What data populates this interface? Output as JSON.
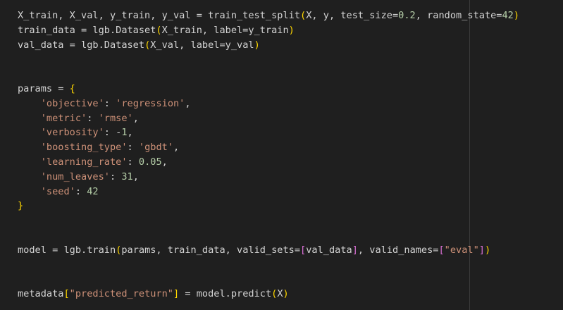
{
  "editor": {
    "language": "python",
    "lines": [
      [
        {
          "text": "X_train, X_val, y_train, y_val = train_test_split",
          "style": "plain"
        },
        {
          "text": "(",
          "style": "b1"
        },
        {
          "text": "X, y, test_size=",
          "style": "plain"
        },
        {
          "text": "0.2",
          "style": "num"
        },
        {
          "text": ", random_state=",
          "style": "plain"
        },
        {
          "text": "42",
          "style": "num"
        },
        {
          "text": ")",
          "style": "b1"
        }
      ],
      [
        {
          "text": "train_data = lgb.Dataset",
          "style": "plain"
        },
        {
          "text": "(",
          "style": "b1"
        },
        {
          "text": "X_train, label=y_train",
          "style": "plain"
        },
        {
          "text": ")",
          "style": "b1"
        }
      ],
      [
        {
          "text": "val_data = lgb.Dataset",
          "style": "plain"
        },
        {
          "text": "(",
          "style": "b1"
        },
        {
          "text": "X_val, label=y_val",
          "style": "plain"
        },
        {
          "text": ")",
          "style": "b1"
        }
      ],
      [],
      [],
      [
        {
          "text": "params = ",
          "style": "plain"
        },
        {
          "text": "{",
          "style": "b1"
        }
      ],
      [
        {
          "text": "    ",
          "style": "plain"
        },
        {
          "text": "'objective'",
          "style": "str"
        },
        {
          "text": ": ",
          "style": "plain"
        },
        {
          "text": "'regression'",
          "style": "str"
        },
        {
          "text": ",",
          "style": "plain"
        }
      ],
      [
        {
          "text": "    ",
          "style": "plain"
        },
        {
          "text": "'metric'",
          "style": "str"
        },
        {
          "text": ": ",
          "style": "plain"
        },
        {
          "text": "'rmse'",
          "style": "str"
        },
        {
          "text": ",",
          "style": "plain"
        }
      ],
      [
        {
          "text": "    ",
          "style": "plain"
        },
        {
          "text": "'verbosity'",
          "style": "str"
        },
        {
          "text": ": -",
          "style": "plain"
        },
        {
          "text": "1",
          "style": "num"
        },
        {
          "text": ",",
          "style": "plain"
        }
      ],
      [
        {
          "text": "    ",
          "style": "plain"
        },
        {
          "text": "'boosting_type'",
          "style": "str"
        },
        {
          "text": ": ",
          "style": "plain"
        },
        {
          "text": "'gbdt'",
          "style": "str"
        },
        {
          "text": ",",
          "style": "plain"
        }
      ],
      [
        {
          "text": "    ",
          "style": "plain"
        },
        {
          "text": "'learning_rate'",
          "style": "str"
        },
        {
          "text": ": ",
          "style": "plain"
        },
        {
          "text": "0.05",
          "style": "num"
        },
        {
          "text": ",",
          "style": "plain"
        }
      ],
      [
        {
          "text": "    ",
          "style": "plain"
        },
        {
          "text": "'num_leaves'",
          "style": "str"
        },
        {
          "text": ": ",
          "style": "plain"
        },
        {
          "text": "31",
          "style": "num"
        },
        {
          "text": ",",
          "style": "plain"
        }
      ],
      [
        {
          "text": "    ",
          "style": "plain"
        },
        {
          "text": "'seed'",
          "style": "str"
        },
        {
          "text": ": ",
          "style": "plain"
        },
        {
          "text": "42",
          "style": "num"
        }
      ],
      [
        {
          "text": "}",
          "style": "b1"
        }
      ],
      [],
      [],
      [
        {
          "text": "model = lgb.train",
          "style": "plain"
        },
        {
          "text": "(",
          "style": "b1"
        },
        {
          "text": "params, train_data, valid_sets=",
          "style": "plain"
        },
        {
          "text": "[",
          "style": "b2"
        },
        {
          "text": "val_data",
          "style": "plain"
        },
        {
          "text": "]",
          "style": "b2"
        },
        {
          "text": ", valid_names=",
          "style": "plain"
        },
        {
          "text": "[",
          "style": "b2"
        },
        {
          "text": "\"eval\"",
          "style": "str"
        },
        {
          "text": "]",
          "style": "b2"
        },
        {
          "text": ")",
          "style": "b1"
        }
      ],
      [],
      [],
      [
        {
          "text": "metadata",
          "style": "plain"
        },
        {
          "text": "[",
          "style": "b1"
        },
        {
          "text": "\"predicted_return\"",
          "style": "str"
        },
        {
          "text": "]",
          "style": "b1"
        },
        {
          "text": " = model.predict",
          "style": "plain"
        },
        {
          "text": "(",
          "style": "b1"
        },
        {
          "text": "X",
          "style": "plain"
        },
        {
          "text": ")",
          "style": "b1"
        }
      ]
    ]
  }
}
